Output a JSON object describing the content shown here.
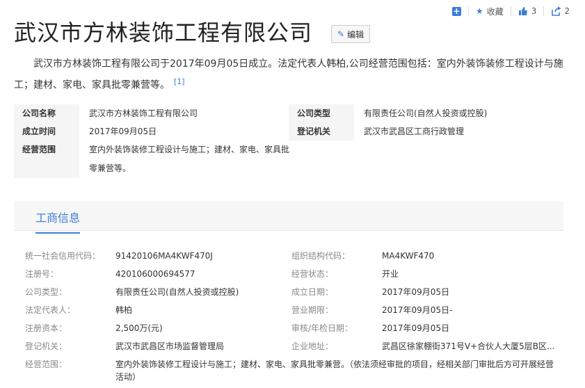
{
  "toolbar": {
    "collect_label": "收藏",
    "like_count": "3",
    "share_count": "2"
  },
  "title": "武汉市方林装饰工程有限公司",
  "edit_label": "编辑",
  "summary": {
    "text": "武汉市方林装饰工程有限公司于2017年09月05日成立。法定代表人韩柏,公司经营范围包括：室内外装饰装修工程设计与施工；建材、家电、家具批零兼营等。",
    "ref": "[1]"
  },
  "infobox": {
    "company_name_label": "公司名称",
    "company_name": "武汉市方林装饰工程有限公司",
    "company_type_label": "公司类型",
    "company_type": "有限责任公司(自然人投资或控股)",
    "founded_label": "成立时间",
    "founded": "2017年09月05日",
    "registry_label": "登记机关",
    "registry": "武汉市武昌区工商行政管理",
    "scope_label": "经营范围",
    "scope": "室内外装饰装修工程设计与施工；建材、家电、家具批零兼营等。"
  },
  "tab_label": "工商信息",
  "business": {
    "credit_code_label": "统一社会信用代码：",
    "credit_code": "91420106MA4KWF470J",
    "org_code_label": "组织结构代码：",
    "org_code": "MA4KWF470",
    "reg_no_label": "注册号：",
    "reg_no": "420106000694577",
    "status_label": "经营状态：",
    "status": "开业",
    "type_label": "公司类型：",
    "type": "有限责任公司(自然人投资或控股)",
    "found_date_label": "成立日期：",
    "found_date": "2017年09月05日",
    "legal_rep_label": "法定代表人：",
    "legal_rep": "韩柏",
    "term_label": "营业期限：",
    "term": "2017年09月05日-",
    "capital_label": "注册资本：",
    "capital": "2,500万(元)",
    "audit_label": "审核/年检日期：",
    "audit": "2017年09月05日",
    "authority_label": "登记机关：",
    "authority": "武汉市武昌区市场监督管理局",
    "address_label": "企业地址：",
    "address": "武昌区徐家棚街371号V+合伙人大厦5层B区...",
    "scope_label": "经营范围：",
    "scope": "室内外装饰装修工程设计与施工；建材、家电、家具批零兼营。（依法须经审批的项目，经相关部门审批后方可开展经营活动）"
  }
}
